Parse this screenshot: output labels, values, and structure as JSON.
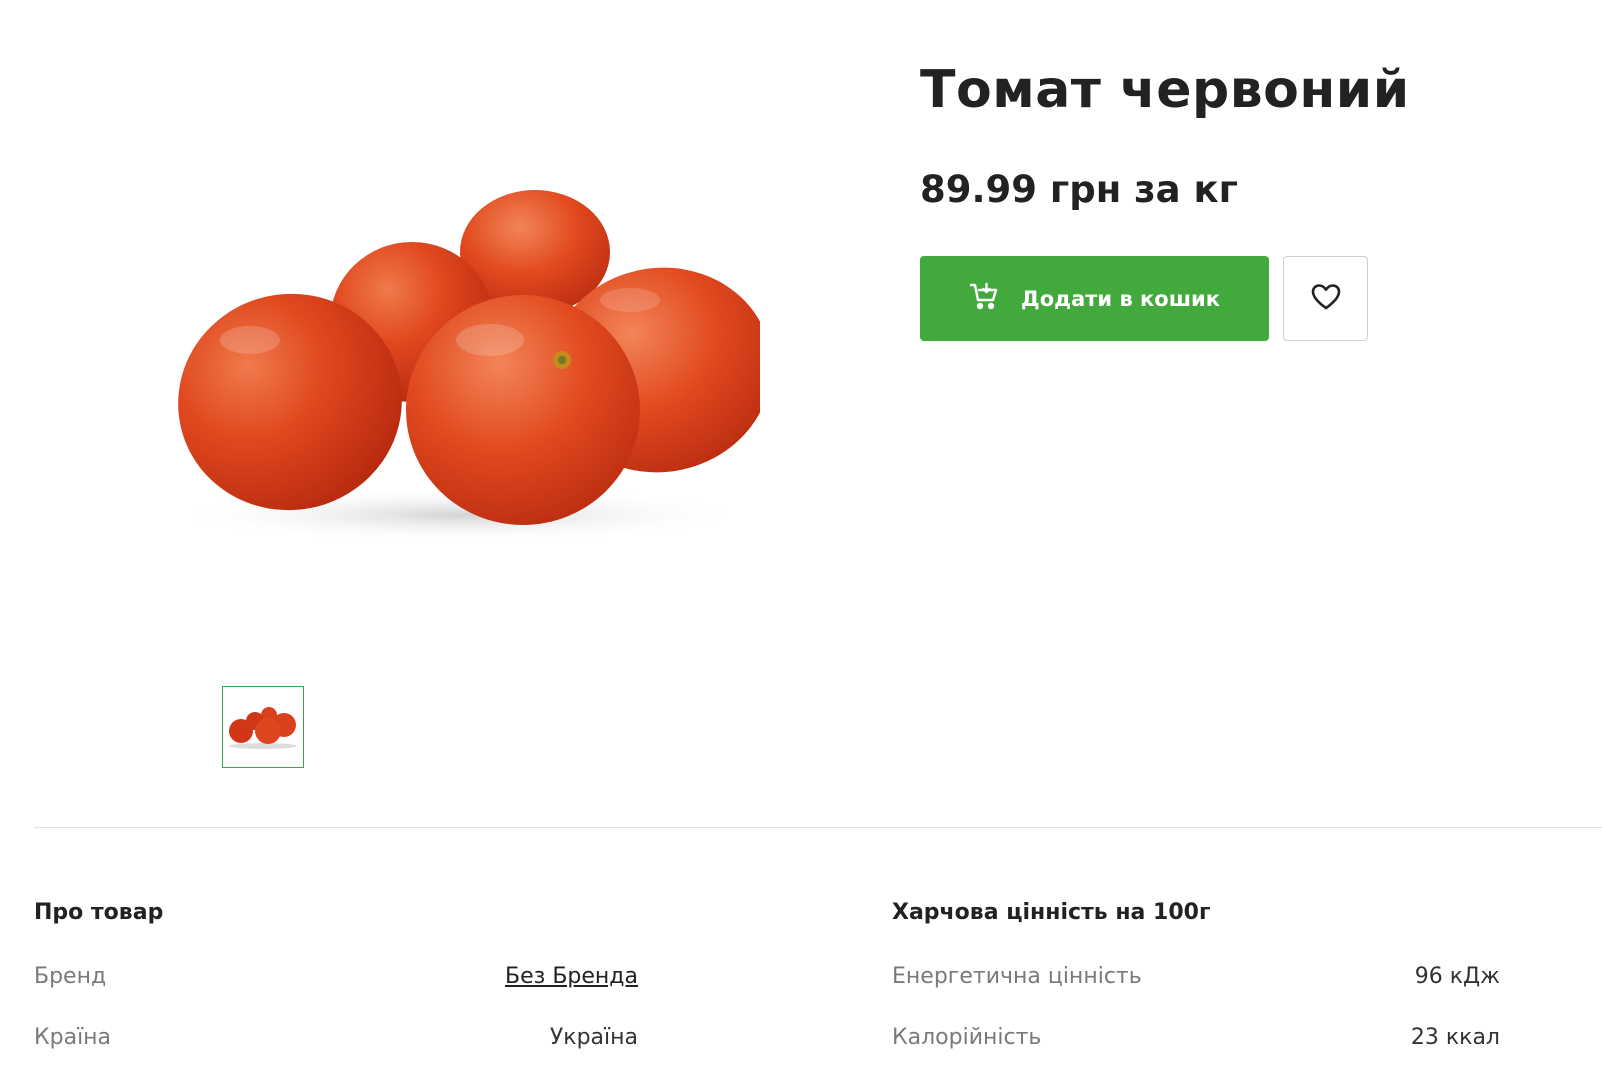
{
  "product": {
    "title": "Томат червоний",
    "price": "89.99 грн за кг",
    "image_alt": "tomatoes"
  },
  "actions": {
    "add_to_cart_label": "Додати в кошик",
    "cart_icon": "cart-add-icon",
    "favorite_icon": "heart-icon"
  },
  "about": {
    "heading": "Про товар",
    "rows": [
      {
        "label": "Бренд",
        "value": "Без Бренда"
      },
      {
        "label": "Країна",
        "value": "Україна"
      }
    ]
  },
  "nutrition": {
    "heading": "Харчова цінність на 100г",
    "rows": [
      {
        "label": "Енергетична цінність",
        "value": "96 кДж"
      },
      {
        "label": "Калорійність",
        "value": "23 ккал"
      }
    ]
  },
  "colors": {
    "accent": "#42a93c",
    "tomato": "#d8391c"
  }
}
